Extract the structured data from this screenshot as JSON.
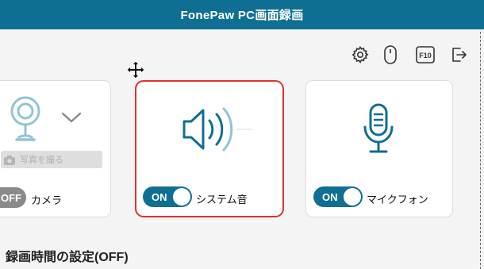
{
  "window": {
    "title": "FonePaw PC画面録画"
  },
  "toolbar": {
    "settings": "gear-icon",
    "mouse": "mouse-icon",
    "hotkey": "F10",
    "exit": "exit-icon"
  },
  "cards": {
    "camera": {
      "photo_button": "写真を撮る",
      "toggle_state": "OFF",
      "label": "カメラ"
    },
    "system_sound": {
      "toggle_state": "ON",
      "label": "システム音",
      "selected": true
    },
    "microphone": {
      "toggle_state": "ON",
      "label": "マイクフォン"
    }
  },
  "recording_time": {
    "title": "録画時間の設定(OFF)"
  },
  "colors": {
    "accent": "#0f6f93",
    "selected_border": "#e0322d",
    "toggle_off": "#8a8a8a"
  }
}
